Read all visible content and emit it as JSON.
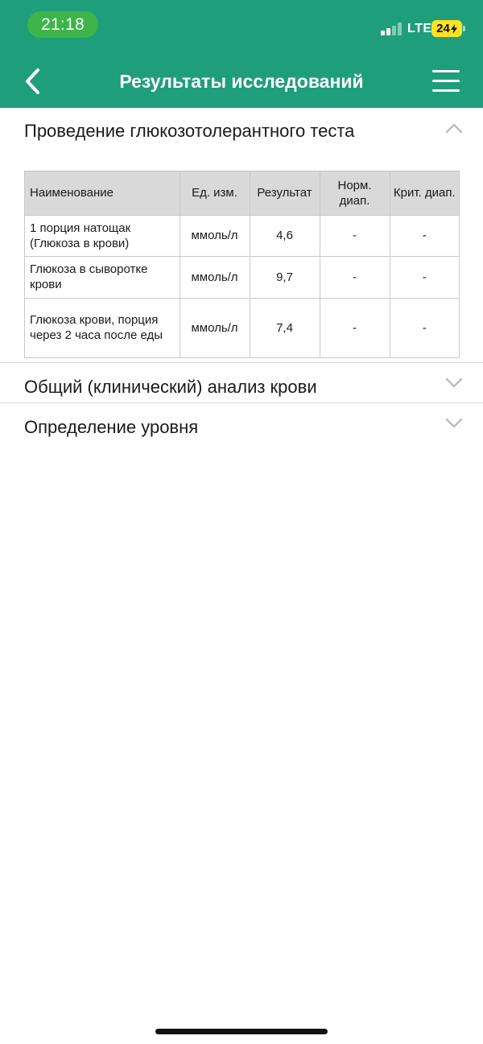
{
  "status_bar": {
    "time": "21:18",
    "network": "LTE",
    "battery": "24"
  },
  "header": {
    "title": "Результаты исследований",
    "back_icon": "chevron-left-icon",
    "menu_icon": "hamburger-menu-icon"
  },
  "sections": [
    {
      "title": "Проведение глюкозотолерантного теста",
      "expanded": true
    },
    {
      "title": "Общий (клинический) анализ крови",
      "expanded": false
    },
    {
      "title": "Определение уровня",
      "expanded": false
    }
  ],
  "table": {
    "headers": [
      "Наименование",
      "Ед. изм.",
      "Результат",
      "Норм. диап.",
      "Крит. диап."
    ],
    "rows": [
      [
        "1 порция натощак (Глюкоза в крови)",
        "ммоль/л",
        "4,6",
        "-",
        "-"
      ],
      [
        "Глюкоза в сыворотке крови",
        "ммоль/л",
        "9,7",
        "-",
        "-"
      ],
      [
        "Глюкоза крови, порция через 2 часа после еды",
        "ммоль/л",
        "7,4",
        "-",
        "-"
      ]
    ]
  },
  "colors": {
    "header_bg": "#1f9e7c",
    "time_pill": "#3db54a",
    "battery": "#ffe224",
    "table_header_bg": "#d9d9d9"
  }
}
